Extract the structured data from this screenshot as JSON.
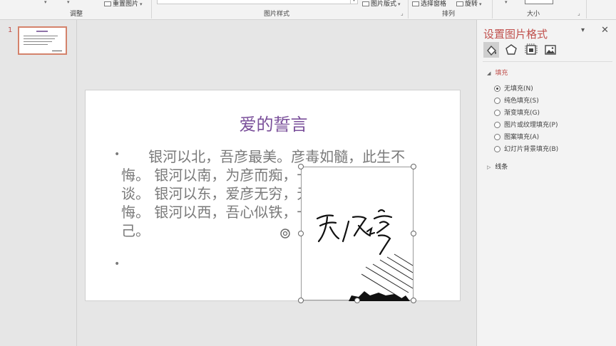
{
  "ribbon": {
    "adjust_group": "调整",
    "reset_picture": "重置图片",
    "picture_styles_group": "图片样式",
    "picture_layout": "图片版式",
    "arrange_group": "排列",
    "selection_pane": "选择窗格",
    "rotate": "旋转",
    "size_group": "大小"
  },
  "thumbnails": {
    "slide_number": "1"
  },
  "slide": {
    "title": "爱的誓言",
    "body": "      银河以北，吾彦最美。彦毒如髓，此生不悔。 银河以南，为彦而痴，一笑一颦，皆是笑谈。 银河以东，爱彦无穷，无缘无份，无怨无悔。 银河以西，吾心似铁，一生一世，为彦终己。",
    "bullet_1": "•",
    "bullet_2": "•"
  },
  "format_pane": {
    "title": "设置图片格式",
    "tabs": [
      "fill-line-icon",
      "effects-icon",
      "size-properties-icon",
      "picture-icon"
    ],
    "fill_section": "填充",
    "fill_options": [
      "无填充(N)",
      "纯色填充(S)",
      "渐变填充(G)",
      "图片或纹理填充(P)",
      "图案填充(A)",
      "幻灯片背景填充(B)"
    ],
    "selected_fill": 0,
    "line_section": "线条"
  },
  "colors": {
    "accent": "#c0504d",
    "title": "#7a4f9a",
    "body_text": "#7a7a7a"
  }
}
